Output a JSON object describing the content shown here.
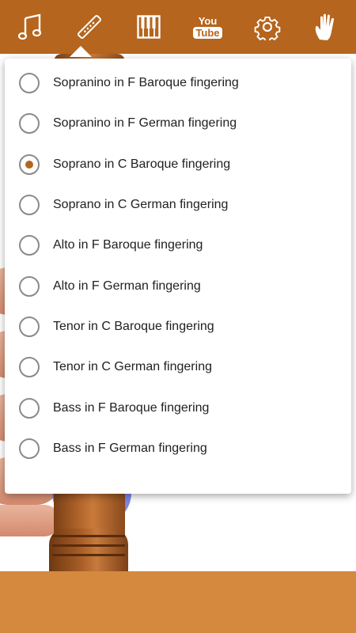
{
  "colors": {
    "toolbar": "#b5651d",
    "accent": "#b5651d",
    "bottom_bar": "#d4893f"
  },
  "toolbar": {
    "items": [
      {
        "icon": "music-notes-icon"
      },
      {
        "icon": "recorder-icon",
        "selected": true
      },
      {
        "icon": "piano-keys-icon"
      },
      {
        "icon": "youtube-icon",
        "line1": "You",
        "line2": "Tube"
      },
      {
        "icon": "gear-icon"
      },
      {
        "icon": "hand-icon"
      }
    ]
  },
  "dialog": {
    "options": [
      {
        "label": "Sopranino in F Baroque fingering",
        "checked": false
      },
      {
        "label": "Sopranino in F German fingering",
        "checked": false
      },
      {
        "label": "Soprano in C Baroque fingering",
        "checked": true
      },
      {
        "label": "Soprano in C German fingering",
        "checked": false
      },
      {
        "label": "Alto in F Baroque fingering",
        "checked": false
      },
      {
        "label": "Alto in F German fingering",
        "checked": false
      },
      {
        "label": "Tenor in C Baroque fingering",
        "checked": false
      },
      {
        "label": "Tenor in C German fingering",
        "checked": false
      },
      {
        "label": "Bass in F Baroque fingering",
        "checked": false
      },
      {
        "label": "Bass in F German fingering",
        "checked": false
      }
    ]
  }
}
